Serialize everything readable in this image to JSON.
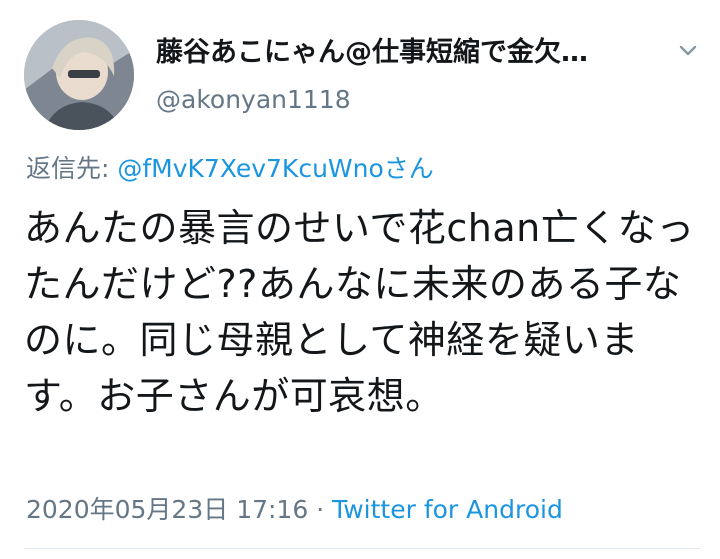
{
  "tweet": {
    "author": {
      "display_name": "藤谷あこにゃん@仕事短縮で金欠…",
      "handle": "@akonyan1118",
      "avatar_icon": "avatar-photo"
    },
    "menu_icon": "chevron-down-icon",
    "reply": {
      "prefix": "返信先: ",
      "mention": "@fMvK7Xev7KcuWnoさん"
    },
    "text": "あんたの暴言のせいで花chan亡くなったんだけど??あんなに未来のある子なのに。同じ母親として神経を疑います。お子さんが可哀想。",
    "timestamp": "2020年05月23日 17:16",
    "separator": " · ",
    "source": "Twitter for Android"
  },
  "colors": {
    "text_primary": "#14171a",
    "text_secondary": "#657786",
    "link": "#1b95e0",
    "divider": "#e1e8ed",
    "background": "#ffffff"
  }
}
